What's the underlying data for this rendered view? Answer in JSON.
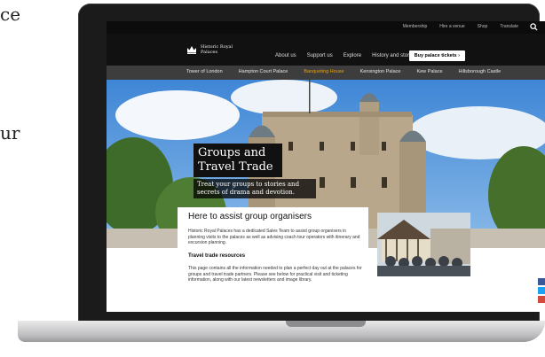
{
  "side_text": {
    "line1": "ce",
    "line2": "ur"
  },
  "utility_nav": [
    "Membership",
    "Hire a venue",
    "Shop",
    "Translate"
  ],
  "logo": {
    "text": "Historic Royal Palaces"
  },
  "main_nav": [
    "About us",
    "Support us",
    "Explore",
    "History and stories"
  ],
  "buy_button": "Buy palace tickets",
  "palace_nav": [
    {
      "label": "Tower of London",
      "active": false
    },
    {
      "label": "Hampton Court Palace",
      "active": false
    },
    {
      "label": "Banqueting House",
      "active": true
    },
    {
      "label": "Kensington Palace",
      "active": false
    },
    {
      "label": "Kew Palace",
      "active": false
    },
    {
      "label": "Hillsborough Castle",
      "active": false
    }
  ],
  "hero": {
    "title": "Groups and Travel Trade",
    "subtitle": "Treat your groups to stories and secrets of drama and devotion."
  },
  "content": {
    "title": "Here to assist group organisers",
    "intro": "Historic Royal Palaces has a dedicated Sales Team to assist group organisers in planning visits to the palaces as well as advising coach tour operators with itinerary and excursion planning.",
    "section_heading": "Travel trade resources",
    "body": "This page contains all the information needed to plan a perfect day out at the palaces for groups and travel trade partners. Please see below for practical visit and ticketing information, along with our latest newsletters and image library."
  },
  "colors": {
    "accent": "#f0a000",
    "header_bg": "#111111",
    "palace_bar": "#3d3d3d"
  }
}
